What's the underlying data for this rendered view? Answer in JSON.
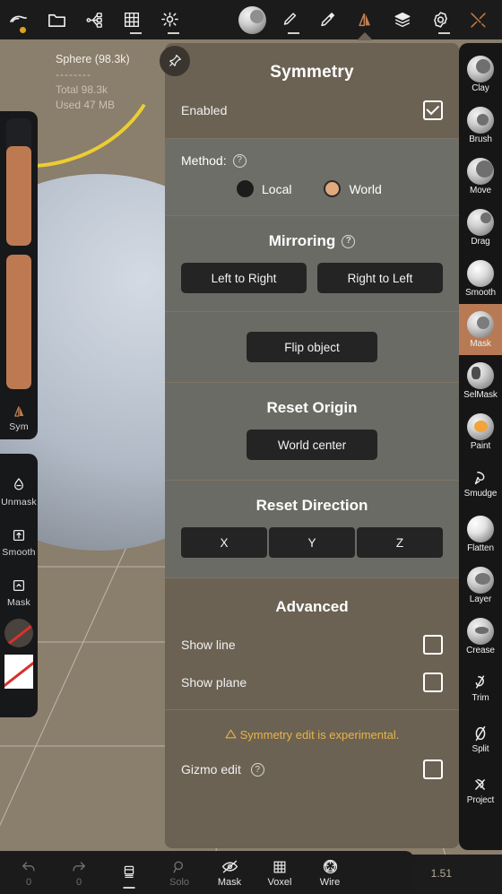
{
  "app": {
    "version": "1.51"
  },
  "topbar": {
    "items": [
      {
        "name": "scene-icon",
        "label": "Scene",
        "badge": "dot"
      },
      {
        "name": "folder-icon",
        "label": "Files"
      },
      {
        "name": "topology-icon",
        "label": "Topology"
      },
      {
        "name": "grid-icon",
        "label": "Grid",
        "underline": true
      },
      {
        "name": "light-icon",
        "label": "Lighting",
        "underline": true
      },
      {
        "name": "material-sphere-icon",
        "label": "Material"
      },
      {
        "name": "brush-icon",
        "label": "Brush",
        "underline": true
      },
      {
        "name": "stamp-icon",
        "label": "Stamp"
      },
      {
        "name": "symmetry-icon",
        "label": "Symmetry",
        "active": true
      },
      {
        "name": "layers-icon",
        "label": "Layers"
      },
      {
        "name": "settings-icon",
        "label": "Settings",
        "underline": true
      },
      {
        "name": "tools-icon",
        "label": "Tools"
      }
    ]
  },
  "stats": {
    "object_name": "Sphere (98.3k)",
    "divider": "--------",
    "total": "Total 98.3k",
    "used": "Used 47 MB"
  },
  "left_rail": {
    "sliders": [
      {
        "name": "brush-radius-slider",
        "fill_percent": 78
      },
      {
        "name": "brush-intensity-slider",
        "fill_percent": 100
      }
    ],
    "sym_label": "Sym",
    "buttons": [
      {
        "name": "unmask-button",
        "label": "Unmask",
        "icon": "unmask-icon"
      },
      {
        "name": "smooth-mask-button",
        "label": "Smooth",
        "icon": "smooth-mask-icon"
      },
      {
        "name": "mask-button",
        "label": "Mask",
        "icon": "mask-icon"
      }
    ],
    "swatches": [
      {
        "name": "material-swatch",
        "kind": "round"
      },
      {
        "name": "color-swatch",
        "kind": "square"
      }
    ]
  },
  "right_rail": {
    "tools": [
      {
        "name": "tool-clay",
        "label": "Clay",
        "active": false
      },
      {
        "name": "tool-brush",
        "label": "Brush",
        "active": false
      },
      {
        "name": "tool-move",
        "label": "Move",
        "active": false
      },
      {
        "name": "tool-drag",
        "label": "Drag",
        "active": false
      },
      {
        "name": "tool-smooth",
        "label": "Smooth",
        "active": false
      },
      {
        "name": "tool-mask",
        "label": "Mask",
        "active": true
      },
      {
        "name": "tool-selmask",
        "label": "SelMask",
        "active": false
      },
      {
        "name": "tool-paint",
        "label": "Paint",
        "active": false
      },
      {
        "name": "tool-smudge",
        "label": "Smudge",
        "active": false
      },
      {
        "name": "tool-flatten",
        "label": "Flatten",
        "active": false
      },
      {
        "name": "tool-layer",
        "label": "Layer",
        "active": false
      },
      {
        "name": "tool-crease",
        "label": "Crease",
        "active": false
      },
      {
        "name": "tool-trim",
        "label": "Trim",
        "active": false
      },
      {
        "name": "tool-split",
        "label": "Split",
        "active": false
      },
      {
        "name": "tool-project",
        "label": "Project",
        "active": false
      }
    ]
  },
  "panel": {
    "title": "Symmetry",
    "enabled": {
      "label": "Enabled",
      "checked": true
    },
    "method": {
      "label": "Method:",
      "options": [
        {
          "label": "Local",
          "selected": false
        },
        {
          "label": "World",
          "selected": true
        }
      ]
    },
    "mirroring": {
      "title": "Mirroring",
      "left_to_right": "Left to Right",
      "right_to_left": "Right to Left",
      "flip_object": "Flip object"
    },
    "reset_origin": {
      "title": "Reset Origin",
      "world_center": "World center"
    },
    "reset_direction": {
      "title": "Reset Direction",
      "axes": [
        "X",
        "Y",
        "Z"
      ]
    },
    "advanced": {
      "title": "Advanced",
      "show_line": {
        "label": "Show line",
        "checked": false
      },
      "show_plane": {
        "label": "Show plane",
        "checked": false
      },
      "warning": "Symmetry edit is experimental.",
      "gizmo_edit": {
        "label": "Gizmo edit",
        "checked": false
      }
    }
  },
  "bottombar": {
    "items": [
      {
        "name": "undo-button",
        "label": "0",
        "icon": "undo-icon",
        "dim": true
      },
      {
        "name": "redo-button",
        "label": "0",
        "icon": "redo-icon",
        "dim": true
      },
      {
        "name": "layers-button",
        "label": "",
        "icon": "pages-icon",
        "underline": true
      },
      {
        "name": "solo-button",
        "label": "Solo",
        "icon": "magnifier-icon",
        "dim": true
      },
      {
        "name": "mask-toggle",
        "label": "Mask",
        "icon": "eye-off-icon"
      },
      {
        "name": "voxel-button",
        "label": "Voxel",
        "icon": "voxel-grid-icon"
      },
      {
        "name": "wire-button",
        "label": "Wire",
        "icon": "wireframe-icon"
      }
    ]
  },
  "colors": {
    "accent": "#b87a55",
    "panel_warm": "#6b6253",
    "panel_grey": "#6e6e69",
    "viewport_bg": "#8a7e6c",
    "warning": "#e8b44a",
    "button": "#242424"
  }
}
